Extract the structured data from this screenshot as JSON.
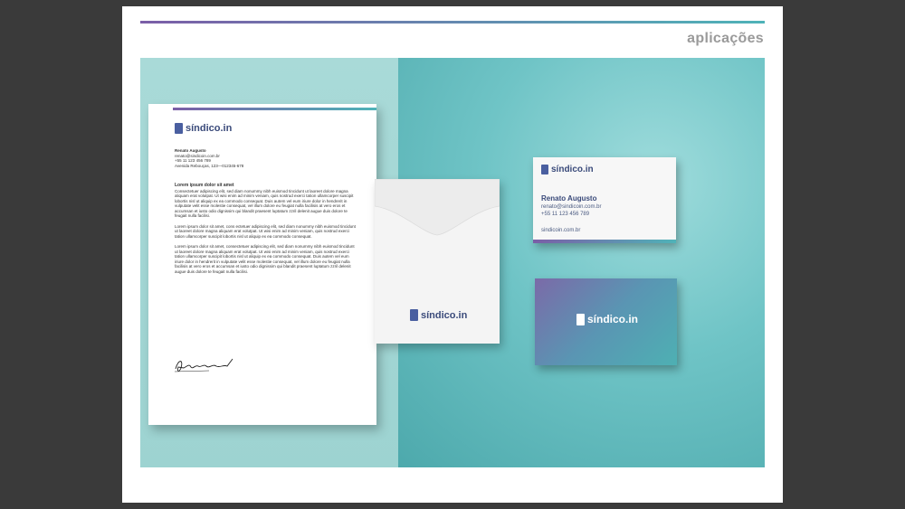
{
  "header": {
    "section_title": "aplicações"
  },
  "brand": {
    "name": "síndico.in",
    "primary_color": "#3a4a7a",
    "accent_gradient": [
      "#7b5ea7",
      "#4fb3b8"
    ]
  },
  "letterhead": {
    "contact": {
      "name": "Renato Augusto",
      "email": "renato@sindicoin.com.br",
      "phone": "+55 11 123 456 789",
      "address": "Avenida Rebouças, 123—012345-678"
    },
    "heading": "Lorem ipsum dolor sit amet",
    "paragraphs": [
      "Consectetuer adipiscing elit, sed diam nonummy nibh euismod tincidunt ut laoreet dolore magna aliquam erat volutpat. Ut wisi enim ad minim veniam, quis nostrud exerci tation ullamcorper suscipit lobortis nisl ut aliquip ex ea commodo consequat. Duis autem vel eum iriure dolor in hendrerit in vulputate velit esse molestie consequat, vel illum dolore eu feugiat nulla facilisis at vero eros et accumsan et iusto odio dignissim qui blandit praesent luptatum zzril delenit augue duis dolore te feugait nulla facilisi.",
      "Lorem ipsum dolor sit amet, cons ectetuer adipiscing elit, sed diam nonummy nibh euismod tincidunt ut laoreet dolore magna aliquam erat volutpat. Ut wisi enim ad minim veniam, quis nostrud exerci tation ullamcorper suscipit lobortis nisl ut aliquip ex ea commodo consequat.",
      "Lorem ipsum dolor sit amet, consectetuer adipiscing elit, sed diam nonummy nibh euismod tincidunt ut laoreet dolore magna aliquam erat volutpat. Ut wisi enim ad minim veniam, quis nostrud exerci tation ullamcorper suscipit lobortis nisl ut aliquip ex ea commodo consequat. Duis autem vel eum iriure dolor in hendrerit in vulputate velit esse molestie consequat, vel illum dolore eu feugiat nulla facilisis at vero eros et accumsan et iusto odio dignissim qui blandit praesent luptatum zzril delenit augue duis dolore te feugait nulla facilisi."
    ]
  },
  "business_card": {
    "name": "Renato Augusto",
    "email": "renato@sindicoin.com.br",
    "phone": "+55 11 123 456 789",
    "website": "sindicoin.com.br"
  }
}
